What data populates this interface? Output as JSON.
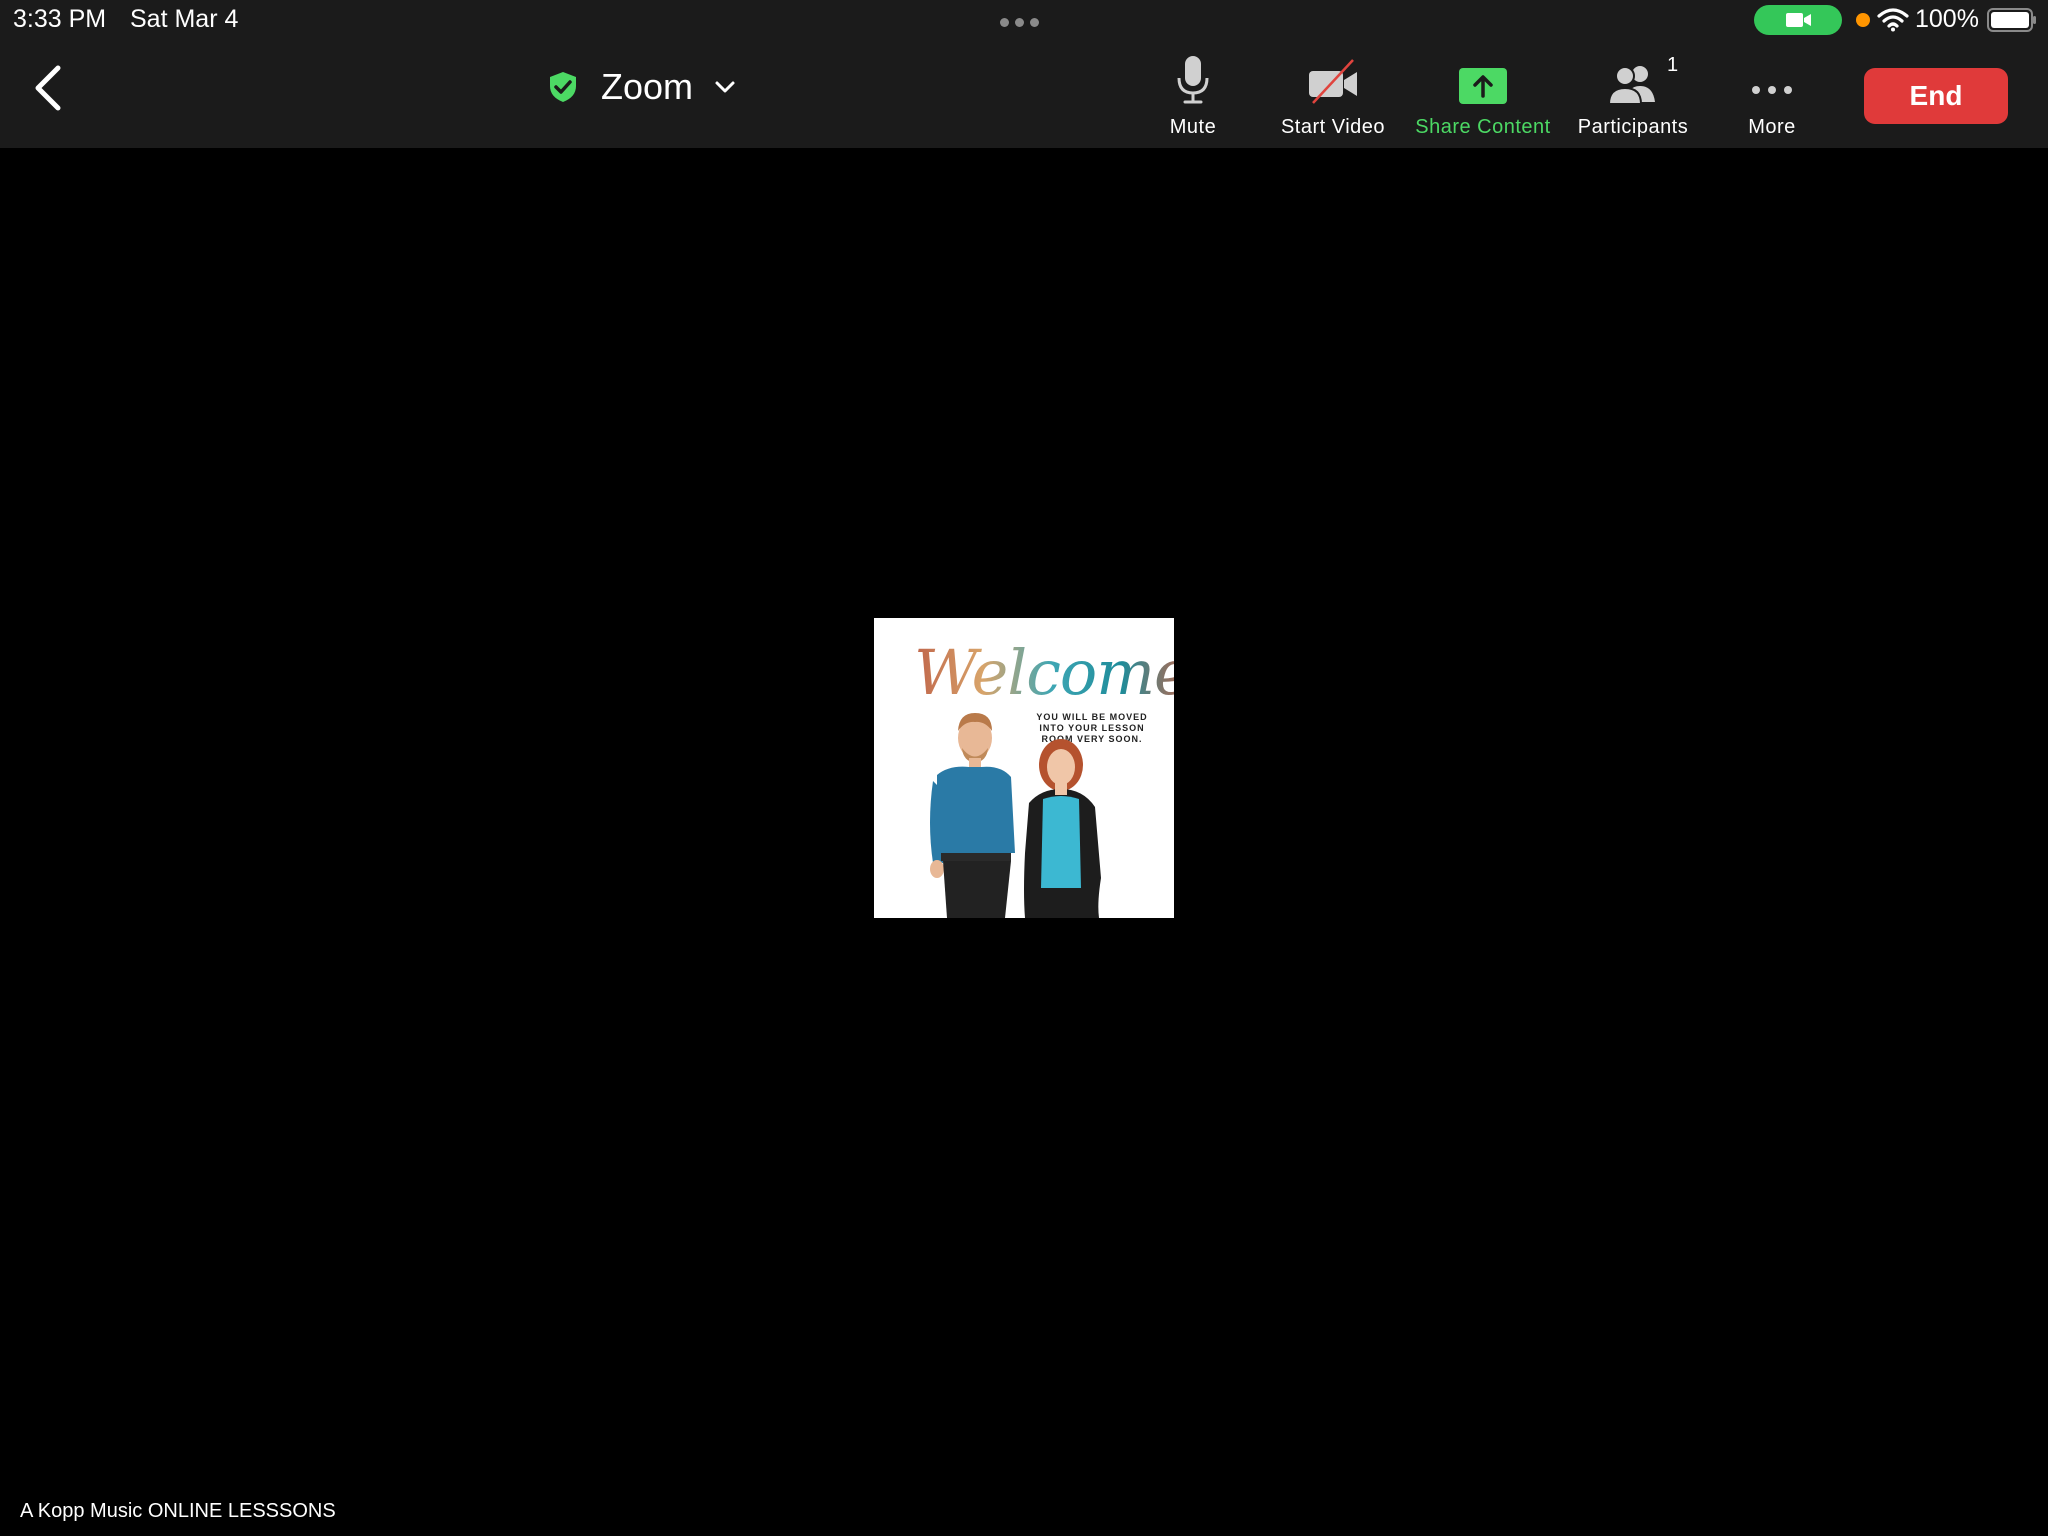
{
  "status_bar": {
    "time": "3:33 PM",
    "date": "Sat Mar 4",
    "battery": "100%",
    "colors": {
      "camera_pill": "#34c759",
      "mic_dot": "#ff9500"
    }
  },
  "toolbar": {
    "title": "Zoom",
    "security_color": "#4cd964",
    "buttons": {
      "mute": "Mute",
      "start_video": "Start Video",
      "share_content": "Share Content",
      "participants": "Participants",
      "more": "More"
    },
    "participant_count": "1",
    "end": "End",
    "colors": {
      "end": "#e03a3a",
      "share": "#4cd964"
    }
  },
  "shared_content": {
    "title": "Welcome",
    "message": "YOU WILL BE MOVED INTO YOUR LESSON ROOM VERY SOON."
  },
  "meeting_name": "A Kopp Music ONLINE LESSSONS"
}
